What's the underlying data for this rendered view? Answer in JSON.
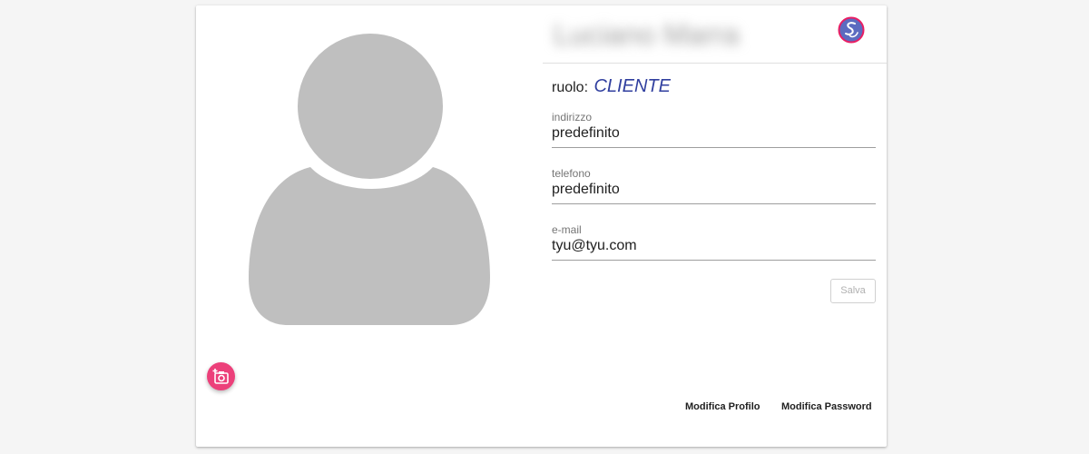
{
  "profile": {
    "name": "Luciano Marra",
    "role_label": "ruolo:",
    "role_value": "CLIENTE"
  },
  "fields": [
    {
      "label": "indirizzo",
      "value": "predefinito"
    },
    {
      "label": "telefono",
      "value": "predefinito"
    },
    {
      "label": "e-mail",
      "value": "tyu@tyu.com"
    }
  ],
  "buttons": {
    "save_label": "Salva",
    "edit_profile_label": "Modifica Profilo",
    "edit_password_label": "Modifica Password"
  },
  "icons": {
    "avatar": "person-silhouette-icon",
    "camera": "add-photo-camera-icon",
    "logo": "sc-logo-icon"
  },
  "colors": {
    "accent": "#ec407a",
    "role": "#303f9f",
    "avatar_gray": "#bdbdbd",
    "logo": "#5c6bc0"
  }
}
